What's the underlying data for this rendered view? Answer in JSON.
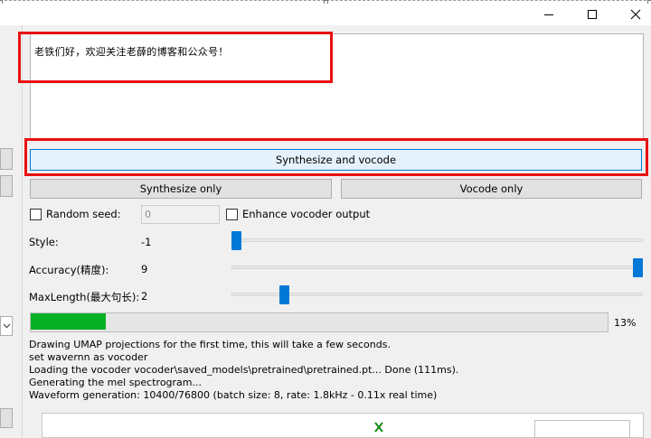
{
  "window": {
    "minimize_icon": "minimize-icon",
    "maximize_icon": "maximize-icon",
    "close_icon": "close-icon"
  },
  "text_input": {
    "value": "老铁们好，欢迎关注老薛的博客和公众号！"
  },
  "buttons": {
    "synthesize_vocode": "Synthesize and vocode",
    "synthesize_only": "Synthesize only",
    "vocode_only": "Vocode only"
  },
  "options": {
    "random_seed_label": "Random seed:",
    "random_seed_checked": false,
    "random_seed_value": "0",
    "enhance_label": "Enhance vocoder output",
    "enhance_checked": false
  },
  "sliders": [
    {
      "label": "Style:",
      "value": "-1",
      "level": 0.0
    },
    {
      "label": "Accuracy(精度):",
      "value": "9",
      "level": 1.0
    },
    {
      "label": "MaxLength(最大句长):",
      "value": "2",
      "level": 0.12
    }
  ],
  "progress": {
    "percent_label": "13%",
    "fraction": 0.13
  },
  "log": [
    "Drawing UMAP projections for the first time, this will take a few seconds.",
    "set wavernn as vocoder",
    "Loading the vocoder vocoder\\saved_models\\pretrained\\pretrained.pt... Done (111ms).",
    "Generating the mel spectrogram...",
    "Waveform generation: 10400/76800 (batch size: 8, rate: 1.8kHz - 0.11x real time)"
  ],
  "colors": {
    "annotation_red": "#e81010",
    "progress_green": "#06b025",
    "slider_blue": "#0078d7",
    "primary_button_border": "#0078d7"
  }
}
